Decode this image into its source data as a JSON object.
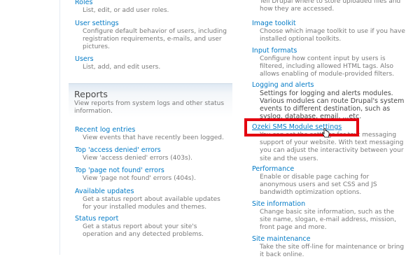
{
  "left": {
    "roles": {
      "title": "Roles",
      "desc": "List, edit, or add user roles."
    },
    "user_settings": {
      "title": "User settings",
      "desc_lines": [
        "Configure default behavior of users, including",
        "registration requirements, e-mails, and user",
        "pictures."
      ]
    },
    "users": {
      "title": "Users",
      "desc": "List, add, and edit users."
    },
    "reports": {
      "title": "Reports",
      "desc_lines": [
        "View reports from system logs and other status",
        "information."
      ]
    },
    "recent_log": {
      "title": "Recent log entries",
      "desc": "View events that have recently been logged."
    },
    "access_denied": {
      "title": "Top 'access denied' errors",
      "desc": "View 'access denied' errors (403s)."
    },
    "page_not_found": {
      "title": "Top 'page not found' errors",
      "desc": "View 'page not found' errors (404s)."
    },
    "available_updates": {
      "title": "Available updates",
      "desc_lines": [
        "Get a status report about available updates",
        "for your installed modules and themes."
      ]
    },
    "status_report": {
      "title": "Status report",
      "desc_lines": [
        "Get a status report about your site's",
        "operation and any detected problems."
      ]
    }
  },
  "right": {
    "file_system_desc": [
      "Tell Drupal where to store uploaded files and",
      "how they are accessed."
    ],
    "image_toolkit": {
      "title": "Image toolkit",
      "desc_lines": [
        "Choose which image toolkit to use if you have",
        "installed optional toolkits."
      ]
    },
    "input_formats": {
      "title": "Input formats",
      "desc_lines": [
        "Configure how content input by users is",
        "filtered, including allowed HTML tags. Also",
        "allows enabling of module-provided filters."
      ]
    },
    "logging": {
      "title": "Logging and alerts",
      "desc_lines": [
        "Settings for logging and alerts modules.",
        "Various modules can route Drupal's system",
        "events to different destination, such as",
        "syslog, database, email, ...etc."
      ]
    },
    "ozeki": {
      "title": "Ozeki SMS Module settings",
      "desc_lines": [
        "You can set the settings for text messaging",
        "support of your website. With text messaging",
        "you can adjust the interactivity between your",
        "site and the users."
      ]
    },
    "performance": {
      "title": "Performance",
      "desc_lines": [
        "Enable or disable page caching for",
        "anonymous users and set CSS and JS",
        "bandwidth optimization options."
      ]
    },
    "site_information": {
      "title": "Site information",
      "desc_lines": [
        "Change basic site information, such as the",
        "site name, slogan, e-mail address, mission,",
        "front page and more."
      ]
    },
    "site_maintenance": {
      "title": "Site maintenance",
      "desc_lines": [
        "Take the site off-line for maintenance or bring",
        "it back online."
      ]
    }
  },
  "colors": {
    "link": "#027ac6",
    "highlight": "#e3000f"
  }
}
